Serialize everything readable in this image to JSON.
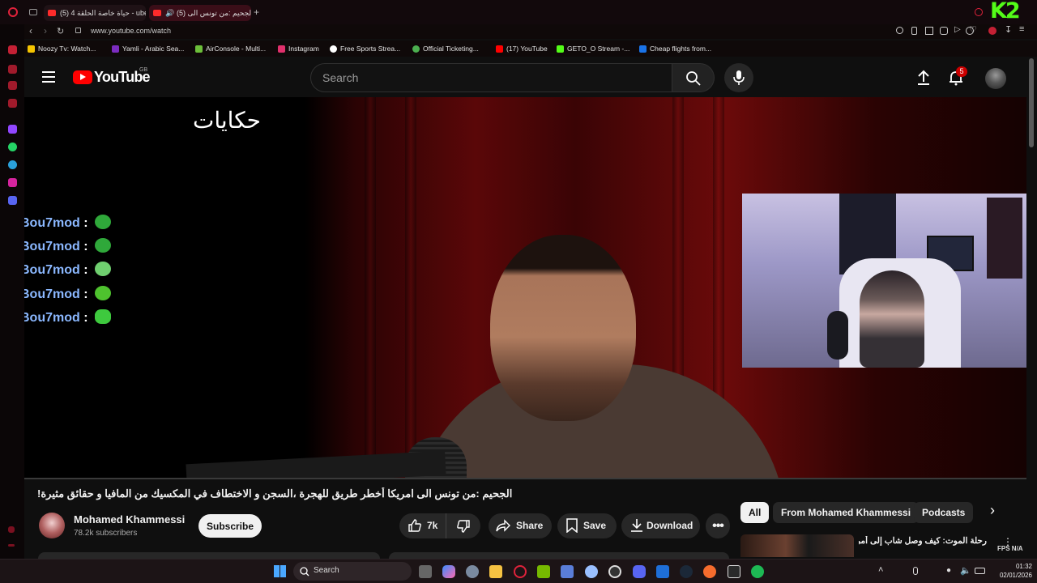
{
  "browser": {
    "tabs": [
      {
        "title": "(5) حياة خاصة الحلقة 4 - ube",
        "active": false
      },
      {
        "title": "(5) الجحيم :من تونس الى",
        "active": true
      }
    ],
    "new_tab": "+",
    "url": "www.youtube.com/watch",
    "bookmarks": [
      {
        "label": "Noozy Tv: Watch...",
        "color": "#f5c400"
      },
      {
        "label": "Yamli - Arabic Sea...",
        "color": "#7b2cbf"
      },
      {
        "label": "AirConsole - Multi...",
        "color": "#6cbf3a"
      },
      {
        "label": "Instagram",
        "color": "#e1306c"
      },
      {
        "label": "Free Sports Strea...",
        "color": "#ffffff"
      },
      {
        "label": "Official Ticketing...",
        "color": "#4caf50"
      },
      {
        "label": "(17) YouTube",
        "color": "#ff0000"
      },
      {
        "label": "GETO_O Stream -...",
        "color": "#53fc18"
      },
      {
        "label": "Cheap flights from...",
        "color": "#1a73e8"
      }
    ],
    "kick_logo": "K2"
  },
  "youtube": {
    "logo": "YouTube",
    "region": "GB",
    "search_placeholder": "Search",
    "notification_count": "5"
  },
  "video": {
    "overlay_logo": "حكايات",
    "chat": [
      {
        "user": "Bou7mod",
        "sep": ":"
      },
      {
        "user": "Bou7mod",
        "sep": ":"
      },
      {
        "user": "Bou7mod",
        "sep": ":"
      },
      {
        "user": "Bou7mod",
        "sep": ":"
      },
      {
        "user": "Bou7mod",
        "sep": ":"
      }
    ],
    "title": "الجحيم :من تونس الى امريكا أخطر طريق للهجرة ،السجن و الاختطاف في المكسيك من المافيا و حقائق مثيرة!"
  },
  "channel": {
    "name": "Mohamed Khammessi",
    "subscribers": "78.2k subscribers",
    "subscribe_label": "Subscribe"
  },
  "actions": {
    "like_count": "7k",
    "share": "Share",
    "save": "Save",
    "download": "Download"
  },
  "chips": {
    "all": "All",
    "from_channel": "From Mohamed Khammessi",
    "podcasts": "Podcasts"
  },
  "recommended": {
    "title": "رحلة الموت: كيف وصل شاب إلى أمريكا"
  },
  "overlay_fps": {
    "label": "FPS",
    "value": "N/A"
  },
  "taskbar": {
    "search": "Search",
    "time": "01:32",
    "date": "02/01/2026"
  }
}
